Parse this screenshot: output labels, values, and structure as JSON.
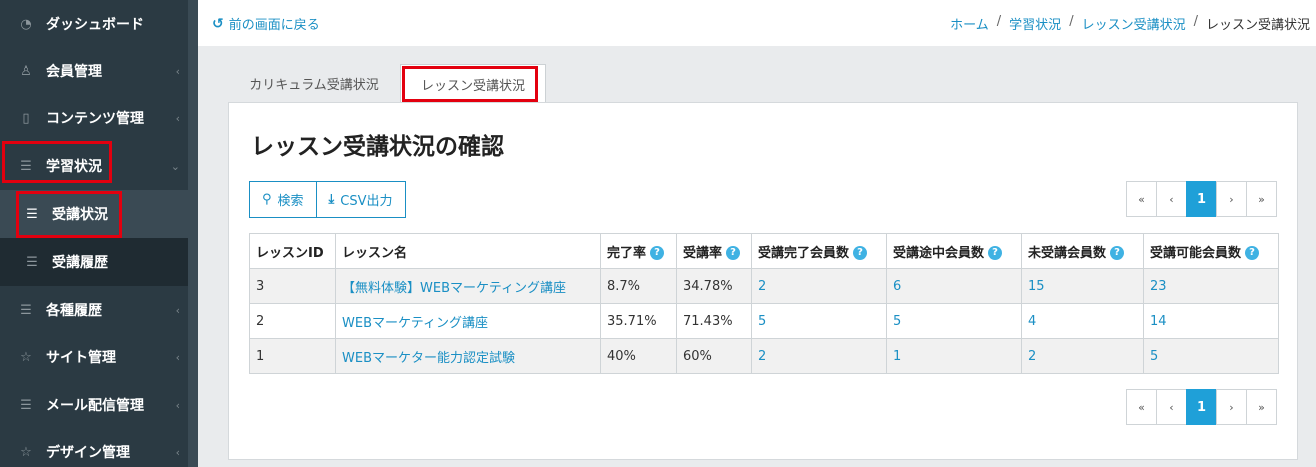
{
  "sidebar": {
    "items": [
      {
        "label": "ダッシュボード",
        "icon": "dashboard-icon",
        "glyph": "◔"
      },
      {
        "label": "会員管理",
        "icon": "user-icon",
        "glyph": "♙"
      },
      {
        "label": "コンテンツ管理",
        "icon": "content-icon",
        "glyph": "▯"
      },
      {
        "label": "学習状況",
        "icon": "list-icon",
        "glyph": "☰"
      },
      {
        "label": "受講状況",
        "icon": "list-icon",
        "glyph": "☰"
      },
      {
        "label": "受講履歴",
        "icon": "list-icon",
        "glyph": "☰"
      },
      {
        "label": "各種履歴",
        "icon": "list-icon",
        "glyph": "☰"
      },
      {
        "label": "サイト管理",
        "icon": "star-icon",
        "glyph": "☆"
      },
      {
        "label": "メール配信管理",
        "icon": "list-icon",
        "glyph": "☰"
      },
      {
        "label": "デザイン管理",
        "icon": "star-icon",
        "glyph": "☆"
      }
    ]
  },
  "header": {
    "back_label": "前の画面に戻る",
    "breadcrumb": [
      "ホーム",
      "学習状況",
      "レッスン受講状況",
      "レッスン受講状況"
    ]
  },
  "tabs": [
    "カリキュラム受講状況",
    "レッスン受講状況"
  ],
  "main": {
    "title": "レッスン受講状況の確認",
    "search_label": "検索",
    "csv_label": "CSV出力",
    "pager": {
      "first": "«",
      "prev": "‹",
      "current": "1",
      "next": "›",
      "last": "»"
    }
  },
  "table": {
    "headers": [
      "レッスンID",
      "レッスン名",
      "完了率",
      "受講率",
      "受講完了会員数",
      "受講途中会員数",
      "未受講会員数",
      "受講可能会員数"
    ],
    "rows": [
      [
        "3",
        "【無料体験】WEBマーケティング講座",
        "8.7%",
        "34.78%",
        "2",
        "6",
        "15",
        "23"
      ],
      [
        "2",
        "WEBマーケティング講座",
        "35.71%",
        "71.43%",
        "5",
        "5",
        "4",
        "14"
      ],
      [
        "1",
        "WEBマーケター能力認定試験",
        "40%",
        "60%",
        "2",
        "1",
        "2",
        "5"
      ]
    ]
  },
  "colors": {
    "accent": "#1a8fc4",
    "sidebar": "#2b3a43",
    "highlight": "#e3000f"
  }
}
